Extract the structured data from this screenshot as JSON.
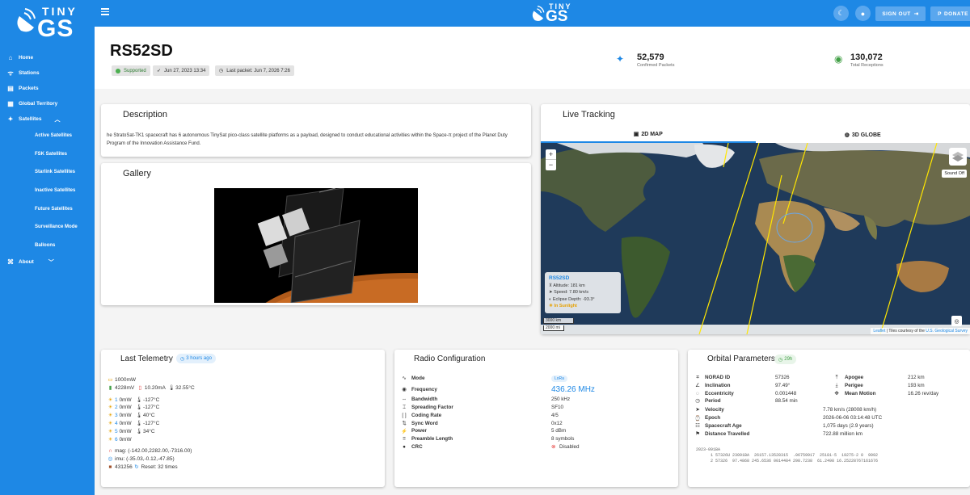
{
  "app": {
    "logo_top": "TINY",
    "logo_bottom": "GS"
  },
  "sidebar": {
    "items": [
      {
        "label": "Home",
        "icon": "home-icon"
      },
      {
        "label": "Stations",
        "icon": "antenna-icon"
      },
      {
        "label": "Packets",
        "icon": "document-icon"
      },
      {
        "label": "Global Territory",
        "icon": "map-icon"
      },
      {
        "label": "Satellites",
        "icon": "satellite-icon"
      }
    ],
    "satellites_sub": [
      "Active Satellites",
      "FSK Satellites",
      "Starlink Satellites",
      "Inactive Satellites",
      "Future Satellites",
      "Surveillance Mode",
      "Balloons"
    ],
    "about": "About"
  },
  "topbar": {
    "signout": "SIGN OUT",
    "donate": "DONATE"
  },
  "header": {
    "name": "RS52SD",
    "supported": "Supported",
    "launch": "Jun 27, 2023 13:34",
    "last_packet": "Last packet: Jun 7, 2026 7:26",
    "confirmed_value": "52,579",
    "confirmed_label": "Confirmed Packets",
    "receptions_value": "130,072",
    "receptions_label": "Total Receptions"
  },
  "description": {
    "title": "Description",
    "text": "he StratoSat-TK1 spacecraft has 6 autonomous TinySat pico-class satellite platforms as a payload, designed to conduct educational activities within the Space-π project of the Planet Duty Program of the Innovation Assistance Fund."
  },
  "gallery": {
    "title": "Gallery"
  },
  "tracking": {
    "title": "Live Tracking",
    "tab_2d": "2D MAP",
    "tab_3d": "3D GLOBE",
    "sound": "Sound Off",
    "popup_name": "RS52SD",
    "altitude": "Altitude: 181 km",
    "speed": "Speed: 7.80 km/s",
    "eclipse": "Eclipse Depth: -93.3°",
    "sunlight": "In Sunlight",
    "scale_km": "3000 km",
    "scale_mi": "2000 mi",
    "attrib_link": "Leaflet",
    "attrib_text": "| Tiles courtesy of the",
    "attrib_link2": "U.S. Geological Survey"
  },
  "telemetry": {
    "title": "Last Telemetry",
    "age": "3 hours ago",
    "power": "1000mW",
    "voltage": "4228mV",
    "current": "10.20mA",
    "temp": "32.55°C",
    "panels": [
      {
        "n": "1",
        "p": "0mW",
        "t": "-127°C"
      },
      {
        "n": "2",
        "p": "0mW",
        "t": "-127°C"
      },
      {
        "n": "3",
        "p": "0mW",
        "t": "40°C"
      },
      {
        "n": "4",
        "p": "0mW",
        "t": "-127°C"
      },
      {
        "n": "5",
        "p": "0mW",
        "t": "34°C"
      },
      {
        "n": "6",
        "p": "0mW",
        "t": ""
      }
    ],
    "mag": "mag: (-142.00,2282.00,-7316.00)",
    "imu": "imu: (-35.03,-0.12,-47.85)",
    "packets": "431256",
    "reset": "Reset: 32 times"
  },
  "radio": {
    "title": "Radio Configuration",
    "rows": [
      {
        "k": "Mode",
        "v": "LoRa"
      },
      {
        "k": "Frequency",
        "v": "436.26 MHz"
      },
      {
        "k": "Bandwidth",
        "v": "250 kHz"
      },
      {
        "k": "Spreading Factor",
        "v": "SF10"
      },
      {
        "k": "Coding Rate",
        "v": "4/5"
      },
      {
        "k": "Sync Word",
        "v": "0x12"
      },
      {
        "k": "Power",
        "v": "5 dBm"
      },
      {
        "k": "Preamble Length",
        "v": "8 symbols"
      },
      {
        "k": "CRC",
        "v": "Disabled"
      }
    ]
  },
  "orbital": {
    "title": "Orbital Parameters",
    "age": "29h",
    "left": [
      {
        "k": "NORAD ID",
        "v": "57326"
      },
      {
        "k": "Inclination",
        "v": "97.49°"
      },
      {
        "k": "Eccentricity",
        "v": "0.001448"
      },
      {
        "k": "Period",
        "v": "88.54 min"
      }
    ],
    "right": [
      {
        "k": "Apogee",
        "v": "212 km"
      },
      {
        "k": "Perigee",
        "v": "193 km"
      },
      {
        "k": "Mean Motion",
        "v": "16.26 rev/day"
      }
    ],
    "wide": [
      {
        "k": "Velocity",
        "v": "7.78 km/s (28008 km/h)"
      },
      {
        "k": "Epoch",
        "v": "2026-06-06 03:14:48 UTC"
      },
      {
        "k": "Spacecraft Age",
        "v": "1,075 days (2.9 years)"
      },
      {
        "k": "Distance Travelled",
        "v": "722.88 million km"
      }
    ],
    "tle0": "2023-091BA",
    "tle1": "1 57326U 23091BA  26157.13528315  .06759917  25181-5  19275-2 0  9992",
    "tle2": "2 57326  97.4868 245.6536 0014484 298.7238  61.2498 16.25228767161676"
  }
}
